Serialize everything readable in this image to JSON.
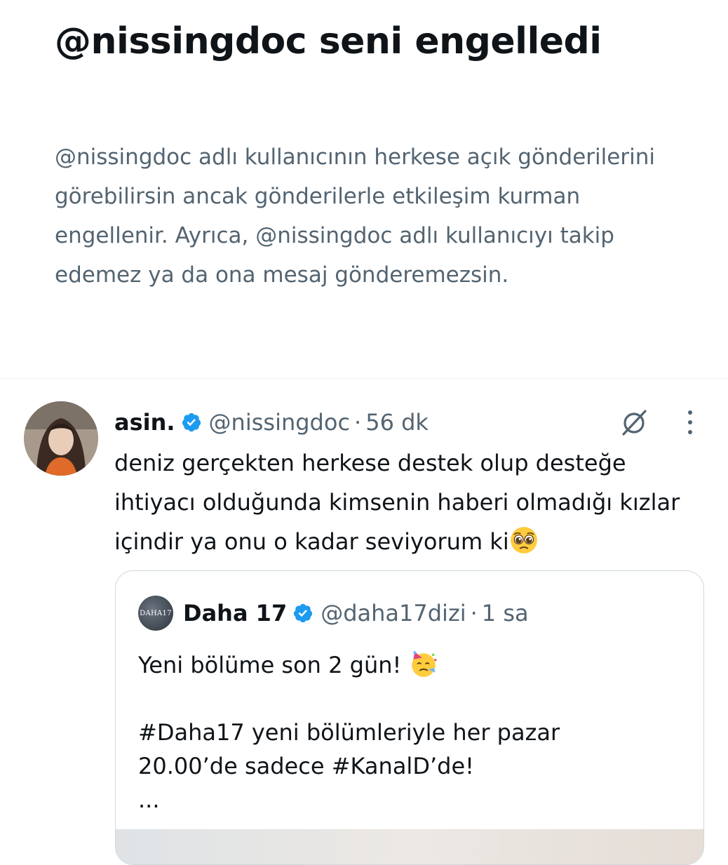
{
  "block_notice": {
    "title": "@nissingdoc seni engelledi",
    "description": "@nissingdoc adlı kullanıcının herkese açık gönderilerini görebilirsin ancak gönderilerle etkileşim kurman engellenir. Ayrıca, @nissingdoc adlı kullanıcıyı takip edemez ya da ona mesaj gönderemezsin."
  },
  "tweet": {
    "author_name": "asin.",
    "handle": "@nissingdoc",
    "separator": "·",
    "time": "56 dk",
    "text": "deniz gerçekten herkese destek olup desteğe ihtiyacı olduğunda kimsenin haberi olmadığı kızlar içindir ya onu o kadar seviyorum ki",
    "emoji": "pleading-face",
    "quote": {
      "avatar_text": "DAHA17",
      "author_name": "Daha 17",
      "handle": "@daha17dizi",
      "separator": "·",
      "time": "1 sa",
      "line1": "Yeni bölüme son 2 gün!",
      "line1_emoji": "partying-face",
      "line2": "#Daha17 yeni bölümleriyle her pazar",
      "line3": "20.00’de sadece #KanalD’de!",
      "line4": "..."
    }
  },
  "colors": {
    "primary_text": "#0f1419",
    "secondary_text": "#536471",
    "verified_blue": "#1d9bf0",
    "border": "#cfd9de"
  }
}
